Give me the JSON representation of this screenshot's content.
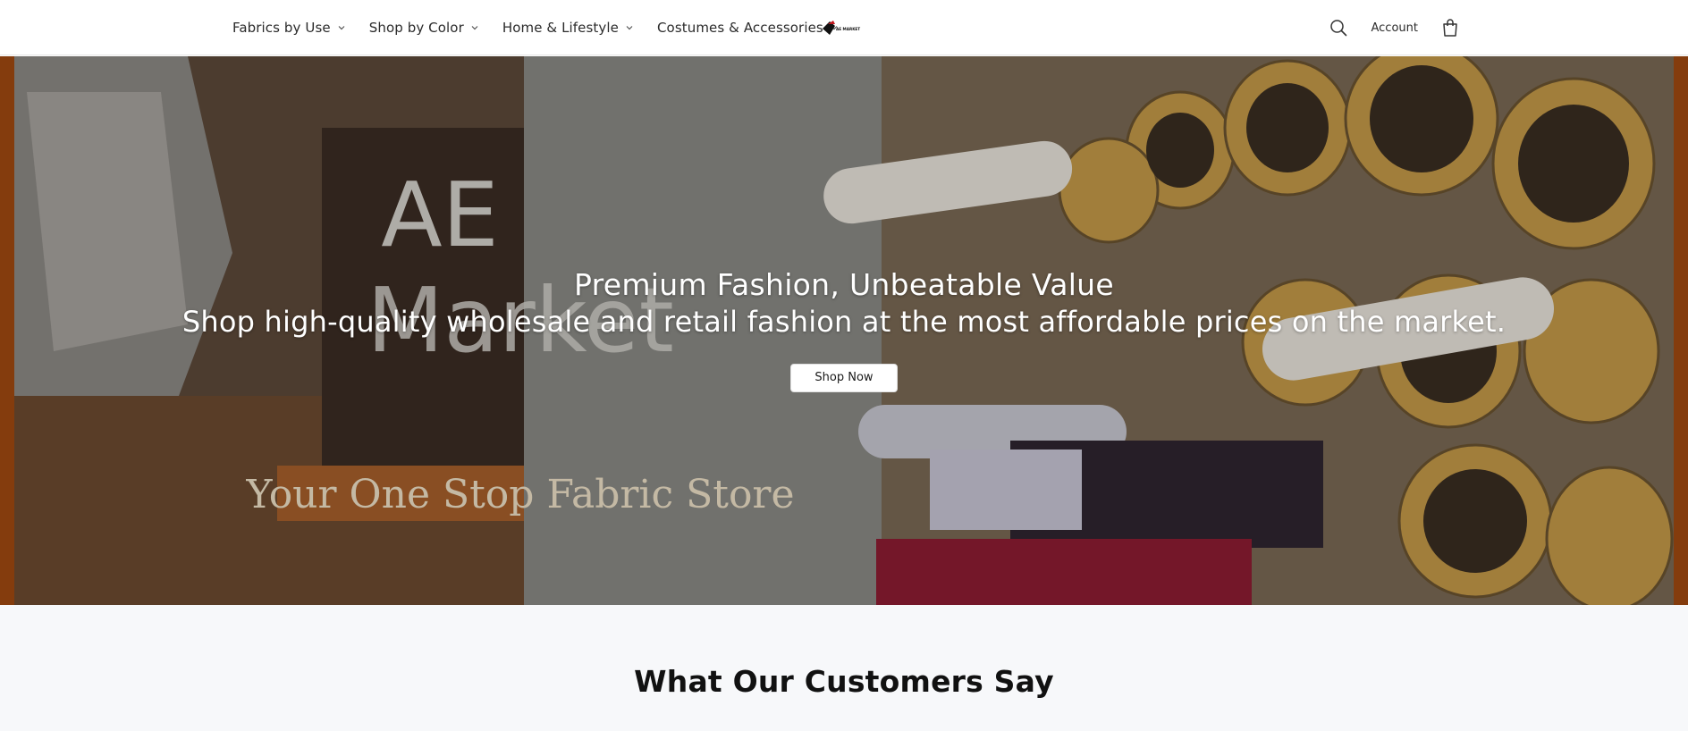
{
  "nav": {
    "items": [
      {
        "label": "Fabrics by Use"
      },
      {
        "label": "Shop by Color"
      },
      {
        "label": "Home & Lifestyle"
      },
      {
        "label": "Costumes & Accessories"
      }
    ]
  },
  "header": {
    "logo_text": "AE MARKET",
    "account_label": "Account",
    "search_icon": "search-icon",
    "cart_icon": "shopping-bag-icon"
  },
  "hero": {
    "title": "Premium Fashion, Unbeatable Value",
    "subtitle": "Shop high-quality wholesale and retail fashion at the most affordable prices on the market.",
    "cta_label": "Shop Now",
    "banner_text_line1": "AE",
    "banner_text_line2": "Market",
    "banner_tagline": "Your One Stop Fabric Store"
  },
  "testimonials": {
    "title": "What Our Customers Say"
  },
  "colors": {
    "accent_orange": "#b5520f",
    "background_light": "#f7f8fa",
    "text_dark": "#1a1a1a"
  }
}
